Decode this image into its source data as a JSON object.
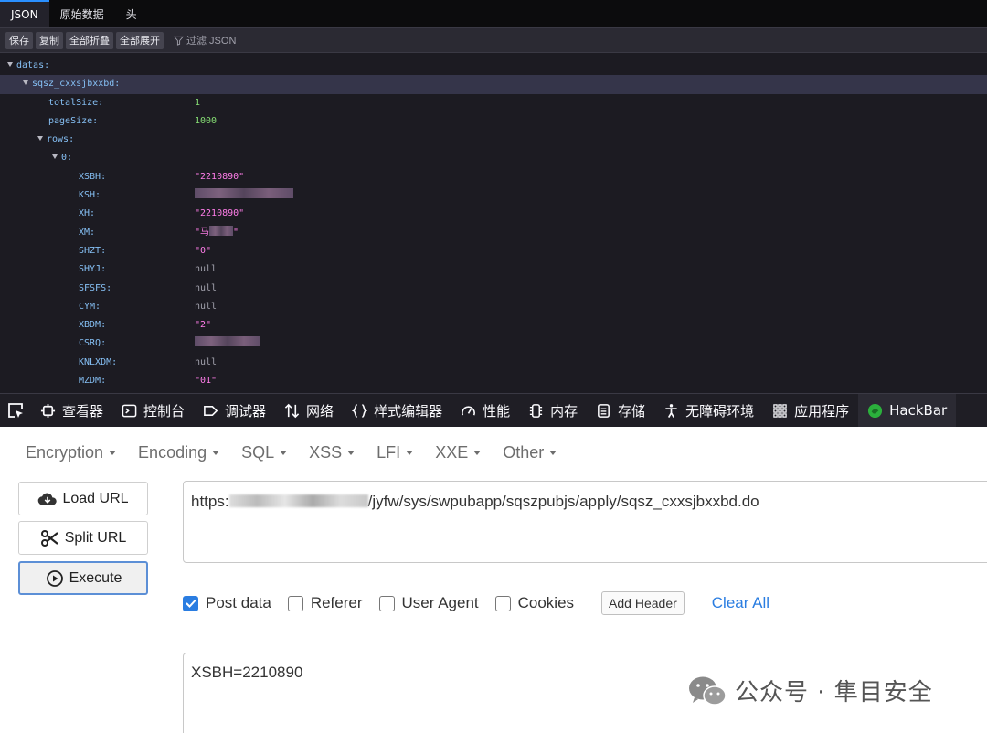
{
  "json_viewer": {
    "tabs": [
      "JSON",
      "原始数据",
      "头"
    ],
    "toolbar": {
      "save": "保存",
      "copy": "复制",
      "collapse_all": "全部折叠",
      "expand_all": "全部展开",
      "filter_placeholder": "过滤 JSON"
    },
    "tree": {
      "datas_key": "datas:",
      "sqsz_key": "sqsz_cxxsjbxxbd:",
      "totalSize_key": "totalSize:",
      "totalSize_val": "1",
      "pageSize_key": "pageSize:",
      "pageSize_val": "1000",
      "rows_key": "rows:",
      "row0_key": "0:",
      "fields": [
        {
          "key": "XSBH:",
          "value": "\"2210890\"",
          "type": "str"
        },
        {
          "key": "KSH:",
          "value": "",
          "type": "redacted"
        },
        {
          "key": "XH:",
          "value": "\"2210890\"",
          "type": "str"
        },
        {
          "key": "XM:",
          "value": "\"马",
          "type": "str"
        },
        {
          "key": "SHZT:",
          "value": "\"0\"",
          "type": "str"
        },
        {
          "key": "SHYJ:",
          "value": "null",
          "type": "null"
        },
        {
          "key": "SFSFS:",
          "value": "null",
          "type": "null"
        },
        {
          "key": "CYM:",
          "value": "null",
          "type": "null"
        },
        {
          "key": "XBDM:",
          "value": "\"2\"",
          "type": "str"
        },
        {
          "key": "CSRQ:",
          "value": "",
          "type": "redacted"
        },
        {
          "key": "KNLXDM:",
          "value": "null",
          "type": "null"
        },
        {
          "key": "MZDM:",
          "value": "\"01\"",
          "type": "str"
        }
      ]
    }
  },
  "devtools": {
    "tabs": [
      "查看器",
      "控制台",
      "调试器",
      "网络",
      "样式编辑器",
      "性能",
      "内存",
      "存储",
      "无障碍环境",
      "应用程序",
      "HackBar"
    ]
  },
  "hackbar": {
    "menu": [
      "Encryption",
      "Encoding",
      "SQL",
      "XSS",
      "LFI",
      "XXE",
      "Other"
    ],
    "buttons": {
      "load_url": "Load URL",
      "split_url": "Split URL",
      "execute": "Execute"
    },
    "url_prefix": "https:",
    "url_suffix": "/jyfw/sys/swpubapp/sqszpubjs/apply/sqsz_cxxsjbxxbd.do",
    "options": {
      "post_data": "Post data",
      "referer": "Referer",
      "user_agent": "User Agent",
      "cookies": "Cookies",
      "post_data_checked": true
    },
    "add_header": "Add Header",
    "clear_all": "Clear All",
    "post_body": "XSBH=2210890"
  },
  "watermark": "公众号 · 隼目安全",
  "colors": {
    "json_bg": "#1c1b22",
    "json_key": "#86c0f5",
    "json_string": "#ff7de9",
    "json_number": "#86de74",
    "hackbar_accent": "#2a7de1"
  }
}
